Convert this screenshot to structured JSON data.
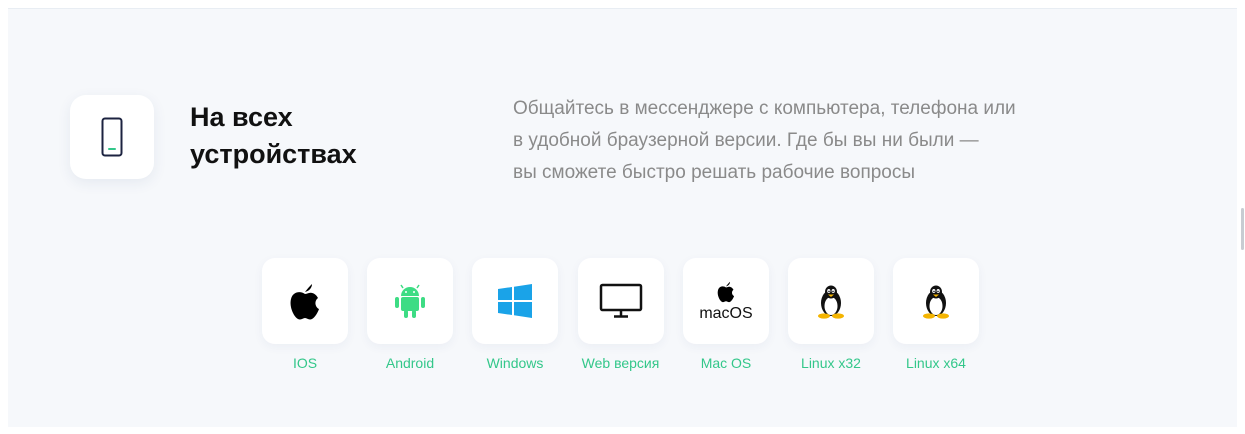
{
  "feature": {
    "title_line1": "На всех",
    "title_line2": "устройствах",
    "icon": "smartphone-icon",
    "description_lines": [
      "Общайтесь в мессенджере с компьютера, телефона или",
      "в удобной браузерной версии. Где бы вы ни были —",
      "вы сможете быстро решать рабочие вопросы"
    ]
  },
  "platforms": [
    {
      "label": "IOS",
      "icon": "apple-icon"
    },
    {
      "label": "Android",
      "icon": "android-icon"
    },
    {
      "label": "Windows",
      "icon": "windows-icon"
    },
    {
      "label": "Web версия",
      "icon": "monitor-icon"
    },
    {
      "label": "Mac OS",
      "icon": "apple-icon",
      "icon_text": "macOS"
    },
    {
      "label": "Linux x32",
      "icon": "tux-linux-icon"
    },
    {
      "label": "Linux x64",
      "icon": "tux-linux-icon"
    }
  ],
  "colors": {
    "accent_green": "#33c78a",
    "windows_blue": "#1aa3e8",
    "android_green": "#3ddc84",
    "section_bg": "#f6f8fb"
  }
}
